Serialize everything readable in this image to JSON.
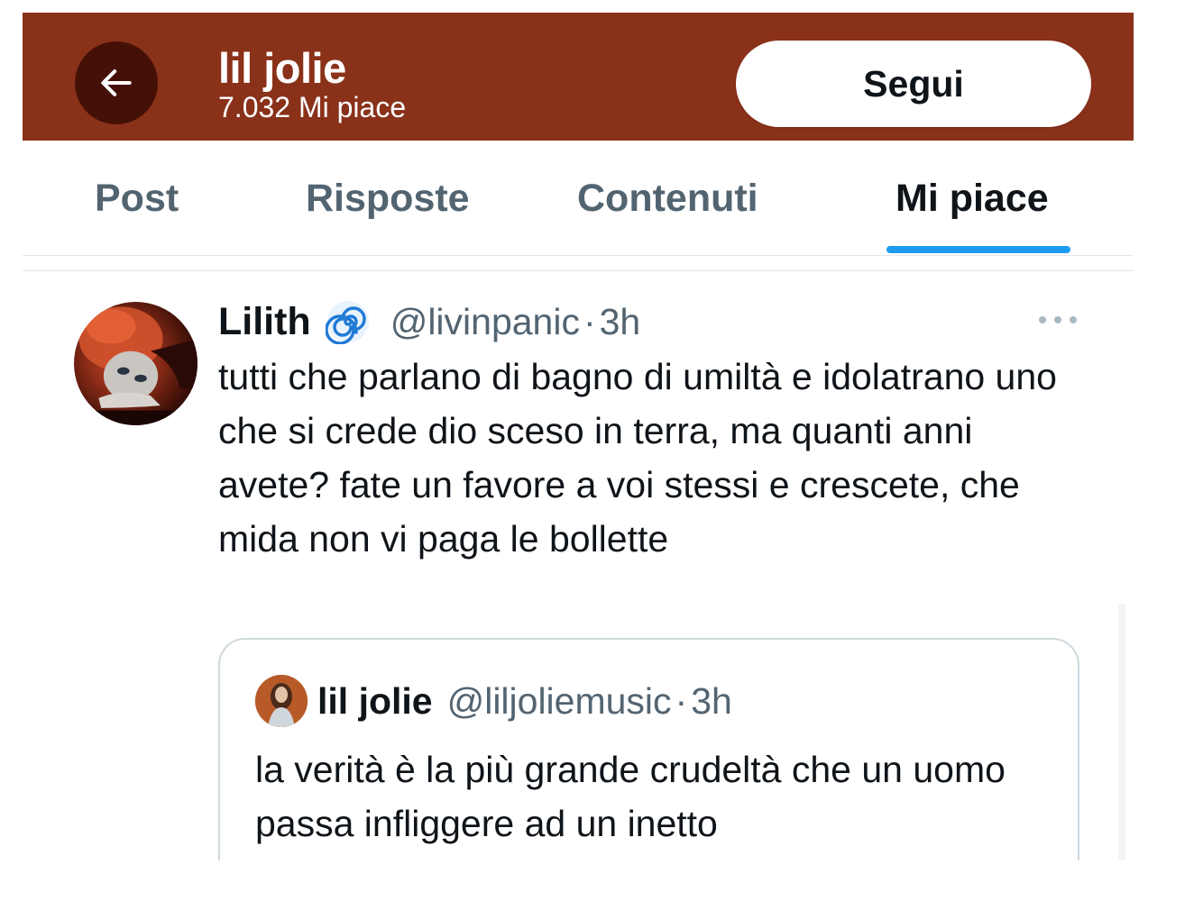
{
  "header": {
    "title": "lil jolie",
    "subtitle": "7.032 Mi piace",
    "follow_label": "Segui",
    "background_color": "#8a311a",
    "back_icon": "arrow-left-icon"
  },
  "tabs": [
    {
      "label": "Post",
      "active": false
    },
    {
      "label": "Risposte",
      "active": false
    },
    {
      "label": "Contenuti",
      "active": false
    },
    {
      "label": "Mi piace",
      "active": true
    }
  ],
  "accent_color": "#1d9bf0",
  "tweet": {
    "name": "Lilith",
    "badge_icon": "cyclone-icon",
    "handle": "@livinpanic",
    "separator": "·",
    "time": "3h",
    "more_icon": "more-horizontal-icon",
    "text": "tutti che parlano di bagno di umiltà e idolatrano uno che si crede dio sceso in terra, ma quanti anni avete? fate un favore a voi stessi e crescete, che mida non vi paga le bollette",
    "quoted": {
      "name": "lil jolie",
      "handle": "@liljoliemusic",
      "separator": "·",
      "time": "3h",
      "text": "la verità è la più grande crudeltà che un uomo passa infliggere ad un inetto"
    }
  }
}
